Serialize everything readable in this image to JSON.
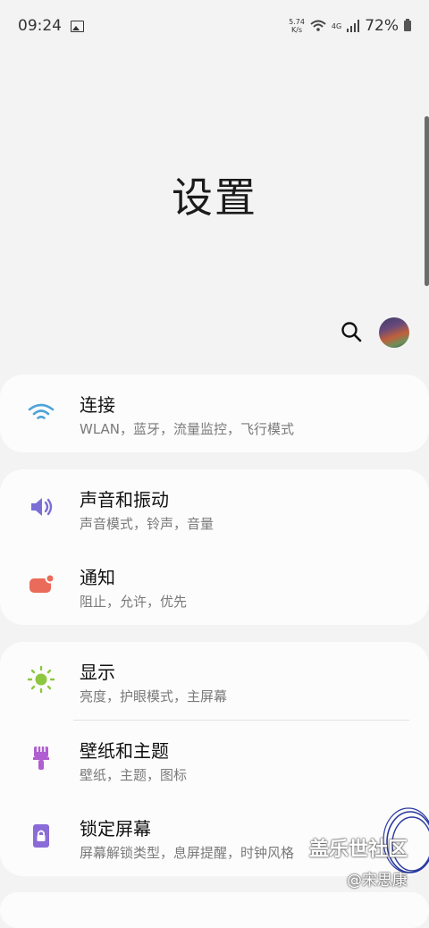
{
  "status_bar": {
    "time": "09:24",
    "speed_value": "5.74",
    "speed_unit": "K/s",
    "network": "4G",
    "battery": "72%"
  },
  "page": {
    "title": "设置"
  },
  "groups": [
    {
      "items": [
        {
          "title": "连接",
          "subtitle": "WLAN，蓝牙，流量监控，飞行模式",
          "icon": "wifi-icon",
          "color": "#4fa3d9"
        }
      ]
    },
    {
      "items": [
        {
          "title": "声音和振动",
          "subtitle": "声音模式，铃声，音量",
          "icon": "speaker-icon",
          "color": "#7b6fd6"
        },
        {
          "title": "通知",
          "subtitle": "阻止，允许，优先",
          "icon": "notification-icon",
          "color": "#ea6b5a"
        }
      ]
    },
    {
      "items": [
        {
          "title": "显示",
          "subtitle": "亮度，护眼模式，主屏幕",
          "icon": "sun-icon",
          "color": "#8dc63f"
        },
        {
          "title": "壁纸和主题",
          "subtitle": "壁纸，主题，图标",
          "icon": "brush-icon",
          "color": "#b05fd0"
        },
        {
          "title": "锁定屏幕",
          "subtitle": "屏幕解锁类型，息屏提醒，时钟风格",
          "icon": "lock-icon",
          "color": "#8a6bd8"
        }
      ]
    }
  ],
  "watermark": {
    "text": "盖乐世社区",
    "user": "@宋思康"
  }
}
